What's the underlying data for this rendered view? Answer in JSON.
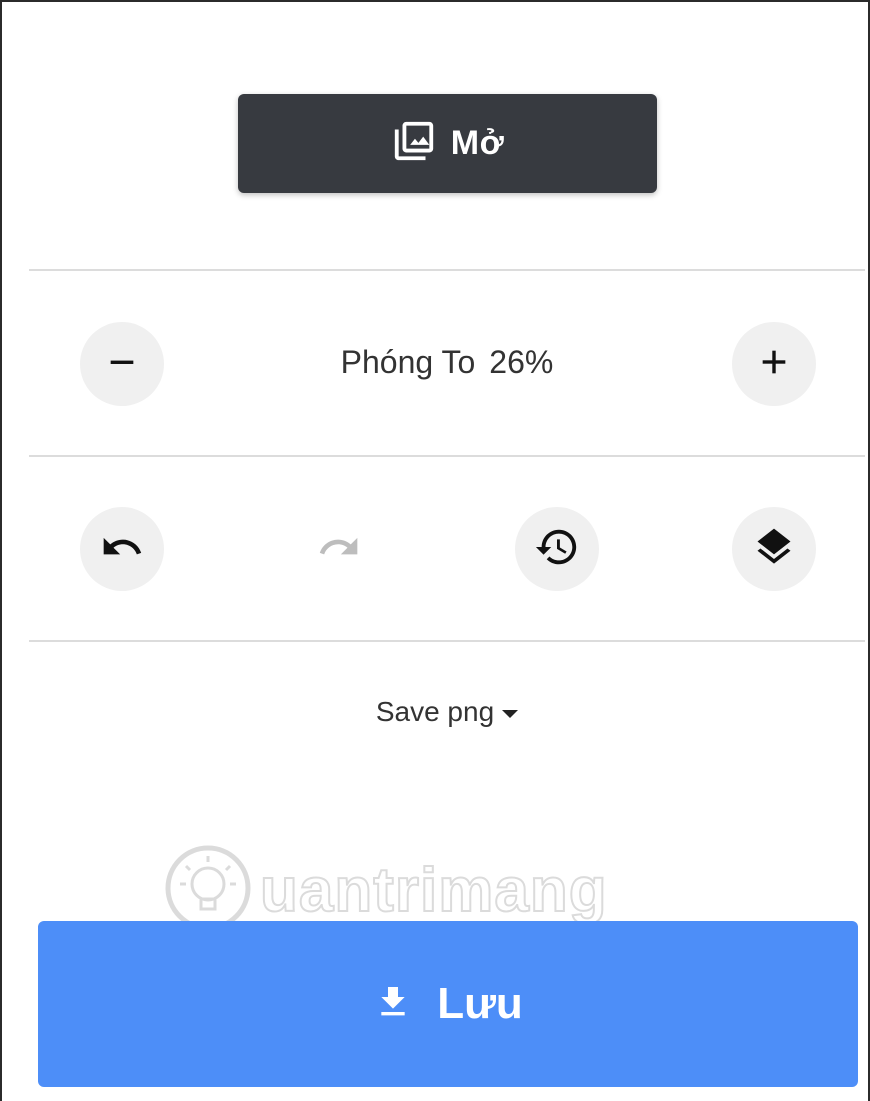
{
  "toolbar": {
    "open_label": "Mở",
    "zoom": {
      "label": "Phóng To",
      "value": "26%"
    },
    "save_format": {
      "label": "Save png"
    },
    "save_label": "Lưu"
  },
  "watermark": {
    "text": "uantrimang"
  },
  "icons": {
    "open": "photo-library-icon",
    "zoom_out": "minus-icon",
    "zoom_in": "plus-icon",
    "undo": "undo-icon",
    "redo": "redo-icon",
    "history": "history-icon",
    "layers": "layers-icon",
    "download": "download-icon",
    "caret": "caret-down-icon"
  },
  "colors": {
    "open_button": "#373a40",
    "save_button": "#4d8ef8",
    "round_button": "#f0f0f0",
    "disabled_icon": "#bdbdbd"
  }
}
